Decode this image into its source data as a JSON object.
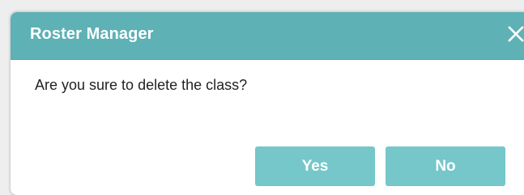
{
  "dialog": {
    "title": "Roster Manager",
    "message": "Are you sure to delete the class?",
    "close_icon": "close-icon",
    "buttons": {
      "yes_label": "Yes",
      "no_label": "No"
    }
  },
  "colors": {
    "titlebar": "#5eb1b5",
    "button": "#75c7c9",
    "text": "#222222",
    "title_text": "#ffffff"
  }
}
